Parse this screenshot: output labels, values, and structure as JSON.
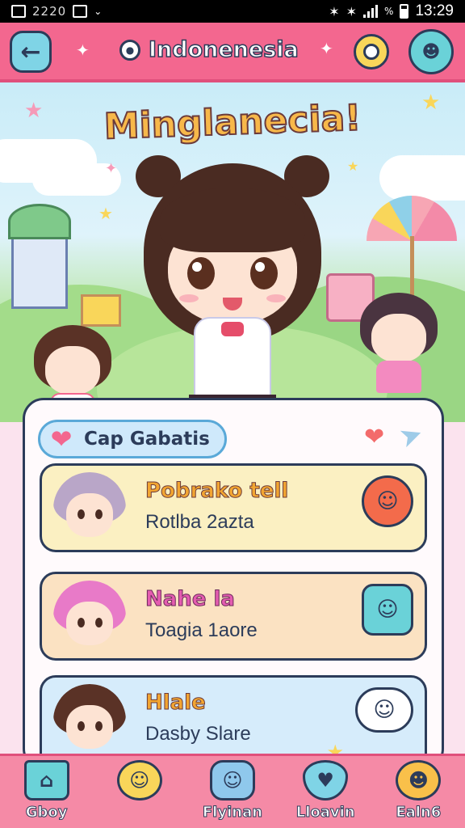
{
  "status_bar": {
    "left_text": "2220",
    "time": "13:29"
  },
  "header": {
    "title": "Indonenesia"
  },
  "hero": {
    "title": "Minglanecia!"
  },
  "panel": {
    "section_title": "Cap Gabatis",
    "cards": [
      {
        "name": "Pobrako tell",
        "subtitle": "Rotlba 2azta",
        "deco_icon": "tomato-face-icon"
      },
      {
        "name": "Nahe la",
        "subtitle": "Toagia 1aore",
        "deco_icon": "chat-bubble-icon"
      },
      {
        "name": "Hlale",
        "subtitle": "Dasby Slare",
        "deco_icon": "cloud-face-icon"
      }
    ]
  },
  "bottom_nav": {
    "items": [
      {
        "label": "Gboy",
        "icon": "home-icon"
      },
      {
        "label": "",
        "icon": "friends-icon"
      },
      {
        "label": "Flyinan",
        "icon": "chat-icon"
      },
      {
        "label": "Lloavin",
        "icon": "heart-icon"
      },
      {
        "label": "Ealn6",
        "icon": "bear-icon"
      }
    ]
  },
  "colors": {
    "header": "#f3678f",
    "accent_blue": "#6ad2d8",
    "accent_yellow": "#f9d65a",
    "outline": "#2c3c5a"
  }
}
